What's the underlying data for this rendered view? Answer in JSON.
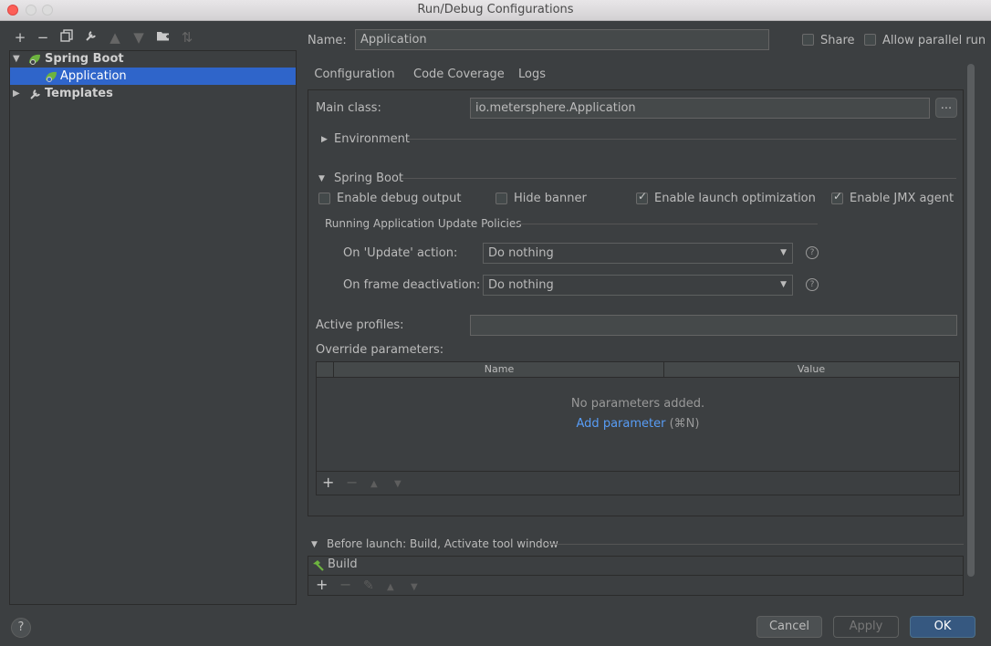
{
  "window": {
    "title": "Run/Debug Configurations"
  },
  "tree": {
    "root": {
      "label": "Spring Boot"
    },
    "child": {
      "label": "Application"
    },
    "templates": {
      "label": "Templates"
    }
  },
  "header": {
    "name_label": "Name:",
    "name_value": "Application",
    "share_label": "Share",
    "allow_parallel_label": "Allow parallel run"
  },
  "tabs": [
    {
      "label": "Configuration"
    },
    {
      "label": "Code Coverage"
    },
    {
      "label": "Logs"
    }
  ],
  "config": {
    "main_class_label": "Main class:",
    "main_class_value": "io.metersphere.Application",
    "browse_label": "...",
    "environment_label": "Environment",
    "spring_boot_label": "Spring Boot",
    "enable_debug_label": "Enable debug output",
    "hide_banner_label": "Hide banner",
    "launch_opt_label": "Enable launch optimization",
    "jmx_label": "Enable JMX agent",
    "policies_label": "Running Application Update Policies",
    "on_update_label": "On 'Update' action:",
    "on_update_value": "Do nothing",
    "on_frame_label": "On frame deactivation:",
    "on_frame_value": "Do nothing",
    "help_glyph": "?",
    "active_profiles_label": "Active profiles:",
    "active_profiles_value": "",
    "override_label": "Override parameters:",
    "col_name": "Name",
    "col_value": "Value",
    "empty_text": "No parameters added.",
    "add_param_link": "Add parameter",
    "add_param_shortcut": "(⌘N)"
  },
  "before_launch": {
    "label": "Before launch: Build, Activate tool window",
    "item": "Build"
  },
  "footer": {
    "help": "?",
    "cancel": "Cancel",
    "apply": "Apply",
    "ok": "OK"
  },
  "checkboxes": {
    "share": false,
    "allow_parallel": false,
    "enable_debug": false,
    "hide_banner": false,
    "launch_opt": true,
    "jmx": true
  }
}
